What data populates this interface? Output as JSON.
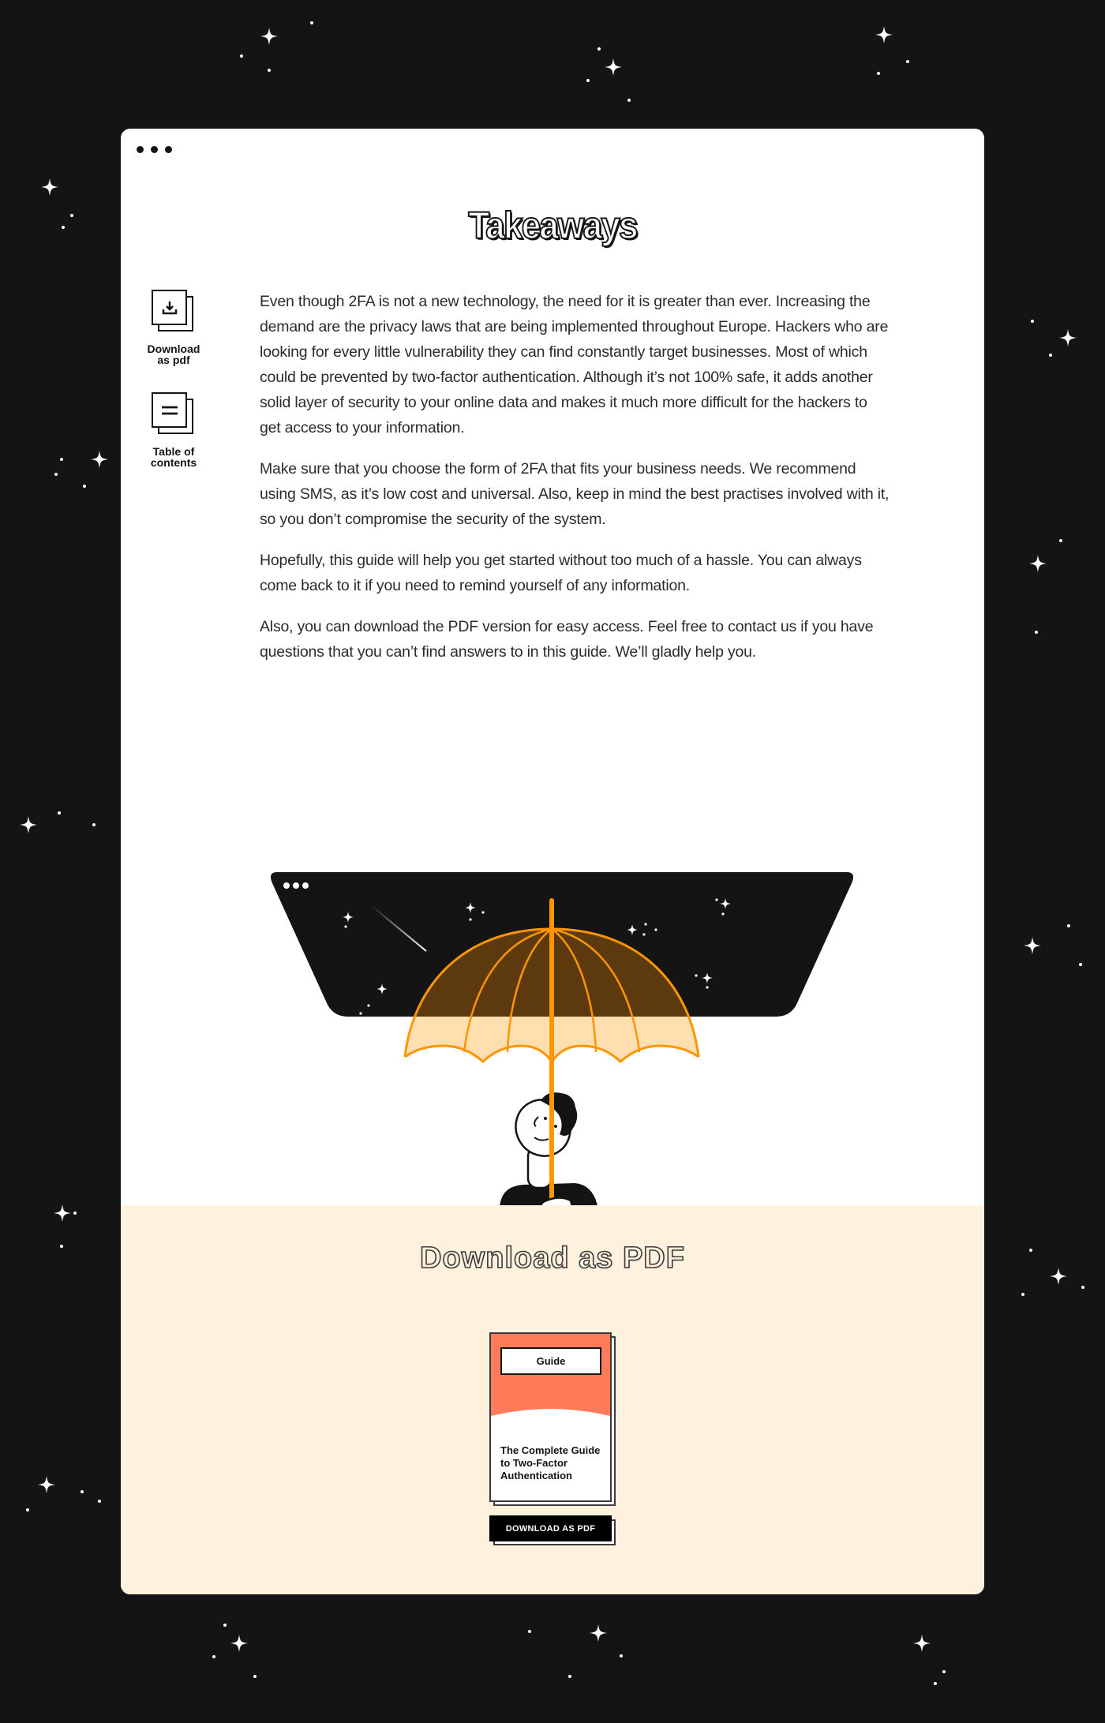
{
  "window": {
    "title_dots": 3,
    "heading": "Takeaways"
  },
  "sidebar": {
    "items": [
      {
        "label_line1": "Download",
        "label_line2": "as pdf",
        "icon": "download-icon"
      },
      {
        "label_line1": "Table of",
        "label_line2": "contents",
        "icon": "table-of-contents-icon"
      }
    ]
  },
  "content": {
    "paragraphs": [
      "Even though 2FA is not a new technology, the need for it is greater than ever. Increasing the demand are the privacy laws that are being implemented throughout Europe. Hackers who are looking for every little vulnerability they can find constantly target businesses. Most of which could be prevented by two-factor authentication. Although it’s not 100% safe, it adds another solid layer of security to your online data and makes it much more difficult for the hackers to get access to your information.",
      "Make sure that you choose the form of 2FA that fits your business needs. We recommend using SMS, as it’s low cost and universal. Also, keep in mind the best practises involved with it, so you don’t compromise the security of the system.",
      "Hopefully, this guide will help you get started without too much of a hassle. You can always come back to it if you need to remind yourself of any information.",
      "Also, you can download the PDF version for easy access. Feel free to contact us if you have questions that you can’t find answers to in this guide. We’ll gladly help you."
    ]
  },
  "illustration": {
    "description": "person-holding-umbrella-under-night-sky"
  },
  "pdf_section": {
    "heading": "Download as PDF",
    "book": {
      "tag": "Guide",
      "title": "The Complete Guide to Two-Factor Authentication"
    },
    "button_label": "DOWNLOAD AS PDF"
  },
  "colors": {
    "background": "#141414",
    "card": "#ffffff",
    "pdf_section_bg": "#fef1de",
    "accent_orange": "#ff9500",
    "umbrella_dark": "#5c3a0e",
    "umbrella_light": "#ffdfb0",
    "book_cover": "#ff7b5a"
  }
}
